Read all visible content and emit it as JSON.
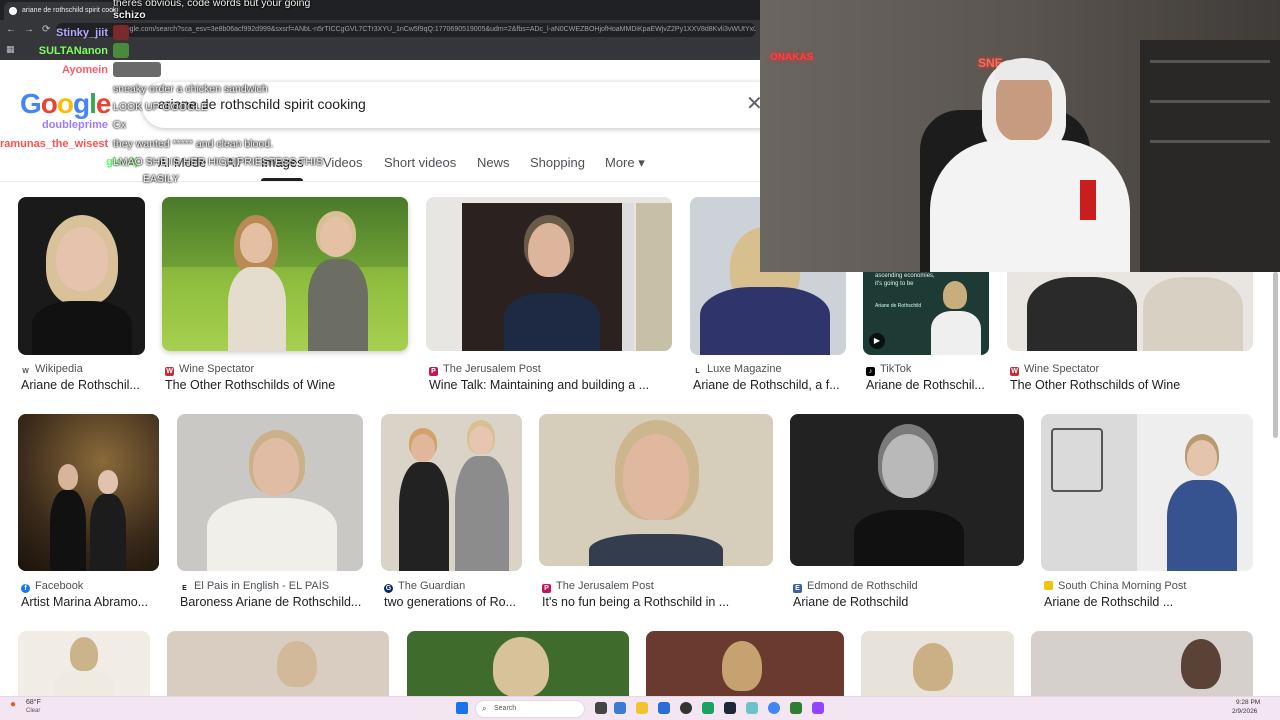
{
  "browser": {
    "tab_title": "ariane de rothschild spirit cooki",
    "tab_close": "×",
    "url": "google.com/search?sca_esv=3e8b06acf992d999&sxsrf=ANbL-n5rTICCgGVL7CTr3XYU_1nCw5f9qQ:1770690519005&udm=2&fbs=ADc_l-aN0CWEZBOHjofHoaMMDiKpaEWjvZ2Py1XXV8d8Kvli3vWUtYx0DZdicpfE1faGYenqW"
  },
  "google": {
    "logo_letters": [
      "G",
      "o",
      "o",
      "g",
      "l",
      "e"
    ],
    "query": "ariane de rothschild spirit cooking",
    "clear_label": "✕",
    "tabs": [
      "AI Mode",
      "All",
      "Images",
      "Videos",
      "Short videos",
      "News",
      "Shopping",
      "More ▾"
    ]
  },
  "results_row1": [
    {
      "source": "Wikipedia",
      "title": "Ariane de Rothschil..."
    },
    {
      "source": "Wine Spectator",
      "title": "The Other Rothschilds of Wine"
    },
    {
      "source": "The Jerusalem Post",
      "title": "Wine Talk: Maintaining and building a ..."
    },
    {
      "source": "Luxe Magazine",
      "title": "Ariane de Rothschild, a f..."
    },
    {
      "source": "TikTok",
      "title": "Ariane de Rothschil..."
    },
    {
      "source": "Wine Spectator",
      "title": "The Other Rothschilds of Wine"
    }
  ],
  "results_row2": [
    {
      "source": "Facebook",
      "title": "Artist Marina Abramo..."
    },
    {
      "source": "El Pais in English - EL PAÍS",
      "title": "Baroness Ariane de Rothschild..."
    },
    {
      "source": "The Guardian",
      "title": "two generations of Ro..."
    },
    {
      "source": "The Jerusalem Post",
      "title": "It's no fun being a Rothschild in ..."
    },
    {
      "source": "Edmond de Rothschild",
      "title": "Ariane de Rothschild"
    },
    {
      "source": "South China Morning Post",
      "title": "Ariane de Rothschild ..."
    }
  ],
  "tiktok_thumb": {
    "line1": "ascending economies,",
    "line2": "it's going to be",
    "caption": "Ariane de Rothschild"
  },
  "chat": [
    {
      "user": "",
      "message": "theres obvious, code words but your going",
      "color": "#ffffff"
    },
    {
      "user": "",
      "message": "schizo",
      "color": "#ffffff"
    },
    {
      "user": "Stinky_jiit",
      "message": "",
      "color": "#b9a6ff"
    },
    {
      "user": "SULTANanon",
      "message": "",
      "color": "#7fff5f"
    },
    {
      "user": "Ayomein",
      "message": "",
      "color": "#ff5b6b"
    },
    {
      "user": "",
      "message": "sneaky order a chicken sandwich",
      "color": "#ffffff"
    },
    {
      "user": "",
      "message": "LOOK UP GOOGLE",
      "color": "#ffffff"
    },
    {
      "user": "doubleprime",
      "message": "Cx",
      "color": "#9b7bff"
    },
    {
      "user": "ramunas_the_wisest",
      "message": "they wanted ***** and clean blood.",
      "color": "#ff4f4f"
    },
    {
      "user": "glo_2j",
      "message": "LMAO SHE IS HER HIGH PRIESTESS THIS",
      "color": "#57ff57"
    },
    {
      "user": "",
      "message": "EASILY",
      "color": "#ffffff"
    }
  ],
  "webcam": {
    "neon_left": "ONAKAS",
    "neon_right": "SNE"
  },
  "taskbar": {
    "weather_temp": "68°F",
    "weather_desc": "Clear",
    "search_label": "Search",
    "time": "9:28 PM",
    "date": "2/9/2026"
  }
}
